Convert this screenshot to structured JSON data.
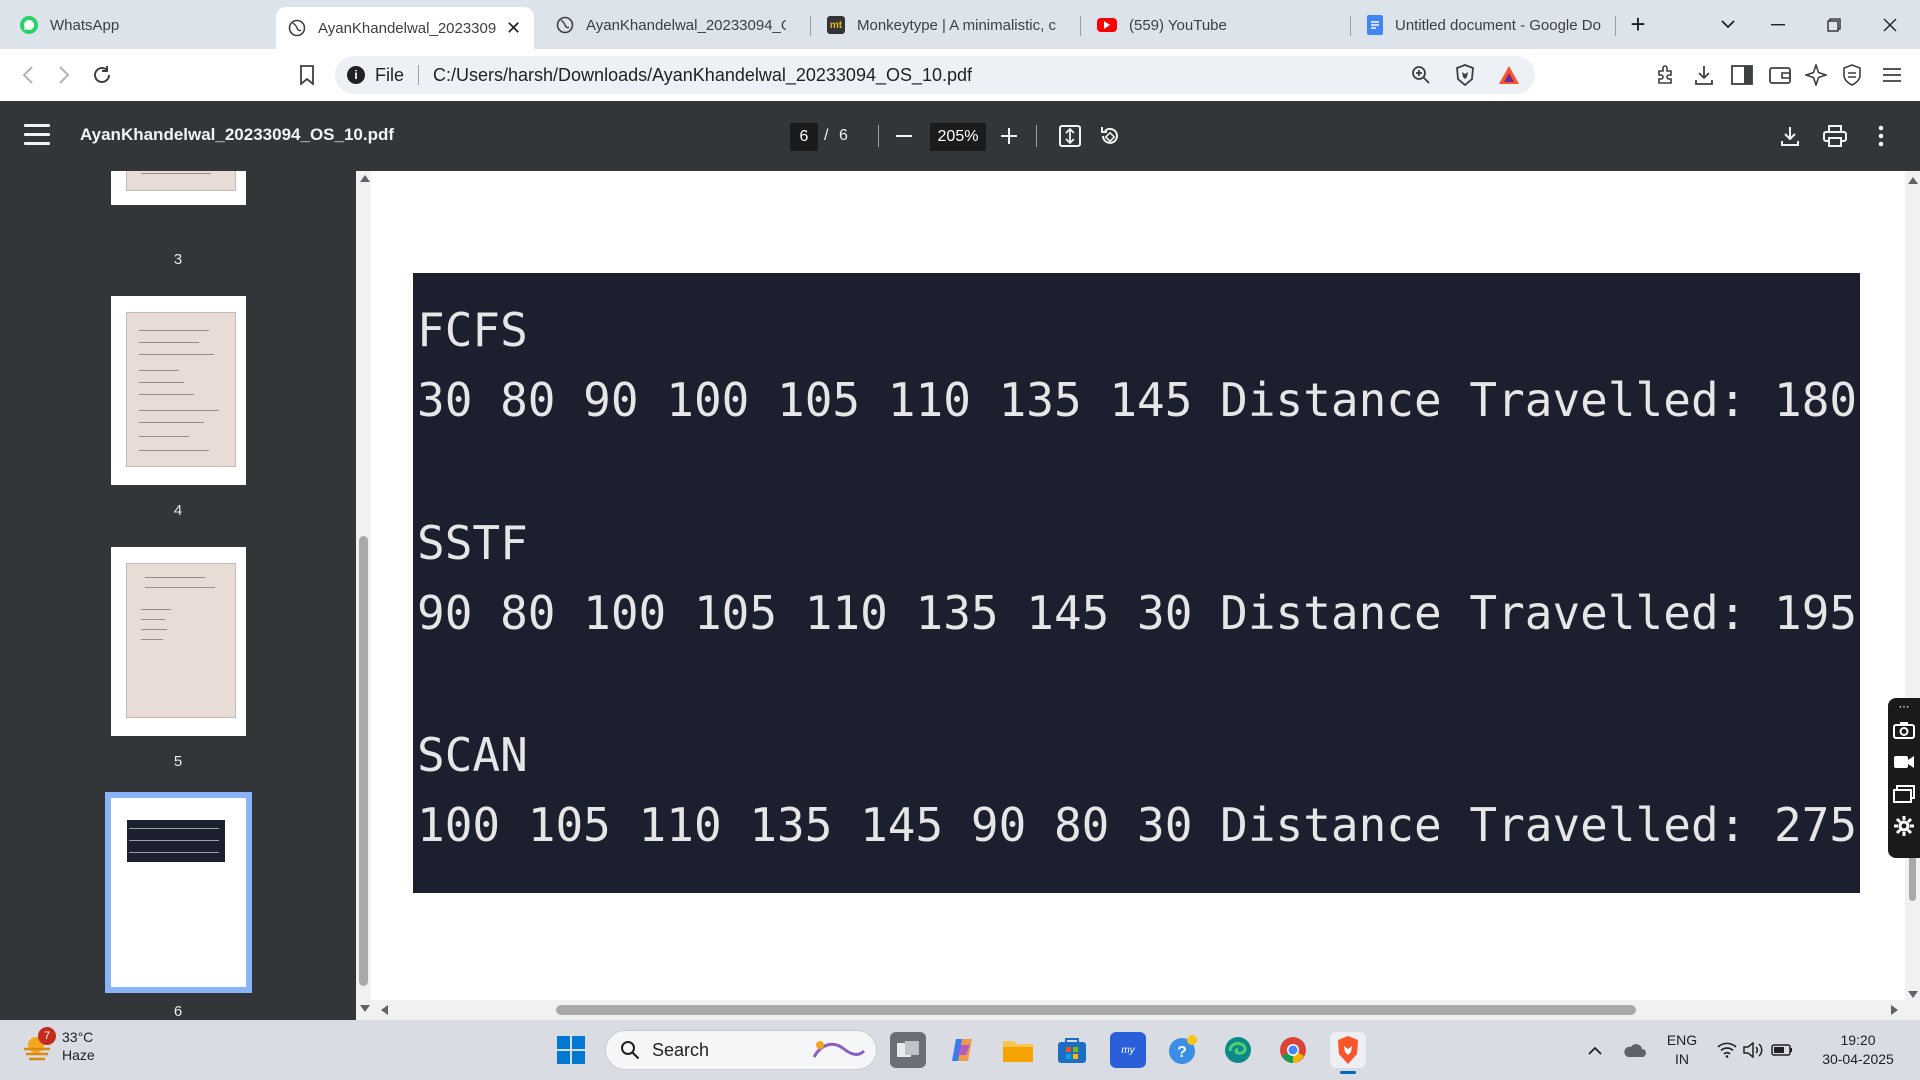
{
  "browser": {
    "tabs": [
      {
        "label": "WhatsApp",
        "icon": "whatsapp-icon",
        "color": "#25d366",
        "active": false
      },
      {
        "label": "AyanKhandelwal_20233094",
        "icon": "globe-icon",
        "color": "#5f6368",
        "active": true
      },
      {
        "label": "AyanKhandelwal_20233094_OS",
        "icon": "globe-icon",
        "color": "#5f6368",
        "active": false
      },
      {
        "label": "Monkeytype | A minimalistic, cu",
        "icon": "monkeytype-icon",
        "color": "#e2b714",
        "active": false
      },
      {
        "label": "(559) YouTube",
        "icon": "youtube-icon",
        "color": "#ff0000",
        "active": false
      },
      {
        "label": "Untitled document - Google Do",
        "icon": "google-docs-icon",
        "color": "#4285f4",
        "active": false
      }
    ],
    "omnibox": {
      "scheme": "File",
      "url": "C:/Users/harsh/Downloads/AyanKhandelwal_20233094_OS_10.pdf"
    }
  },
  "pdf": {
    "filename": "AyanKhandelwal_20233094_OS_10.pdf",
    "current_page": "6",
    "page_separator": "/",
    "total_pages": "6",
    "zoom": "205%",
    "thumbnails": [
      {
        "number": "3"
      },
      {
        "number": "4"
      },
      {
        "number": "5"
      },
      {
        "number": "6",
        "selected": true
      }
    ]
  },
  "document": {
    "terminal_lines": [
      "FCFS",
      "30 80 90 100 105 110 135 145 Distance Travelled: 180",
      "",
      "SSTF",
      "90 80 100 105 110 135 145 30 Distance Travelled: 195",
      "",
      "SCAN",
      "100 105 110 135 145 90 80 30 Distance Travelled: 275"
    ]
  },
  "taskbar": {
    "weather": {
      "temp": "33°C",
      "condition": "Haze",
      "badge": "7"
    },
    "search_placeholder": "Search",
    "language": {
      "line1": "ENG",
      "line2": "IN"
    },
    "clock": {
      "time": "19:20",
      "date": "30-04-2025"
    }
  }
}
